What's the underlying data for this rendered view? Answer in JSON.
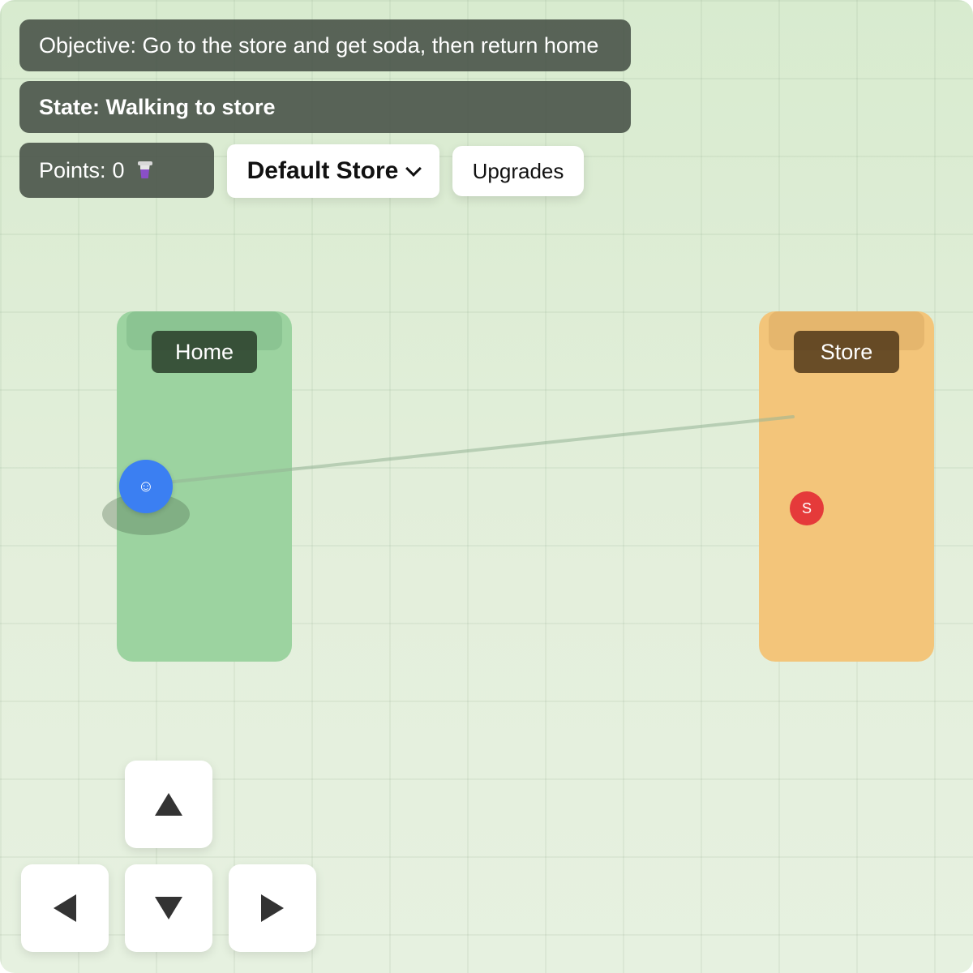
{
  "hud": {
    "objective": "Objective: Go to the store and get soda, then return home",
    "state": "State: Walking to store",
    "points_label": "Points:",
    "points_value": "0",
    "points_icon": "soda-cup-icon"
  },
  "store_select": {
    "selected": "Default Store"
  },
  "upgrades": {
    "label": "Upgrades"
  },
  "zones": {
    "home": {
      "label": "Home",
      "color": "#9cd3a0"
    },
    "store": {
      "label": "Store",
      "color": "#f3c57a"
    }
  },
  "player": {
    "glyph": "☺",
    "color": "#3b7ff2"
  },
  "shopkeeper": {
    "glyph": "S",
    "color": "#e53a3a"
  },
  "controls": {
    "up_icon": "arrow-up-icon",
    "down_icon": "arrow-down-icon",
    "left_icon": "arrow-left-icon",
    "right_icon": "arrow-right-icon"
  }
}
